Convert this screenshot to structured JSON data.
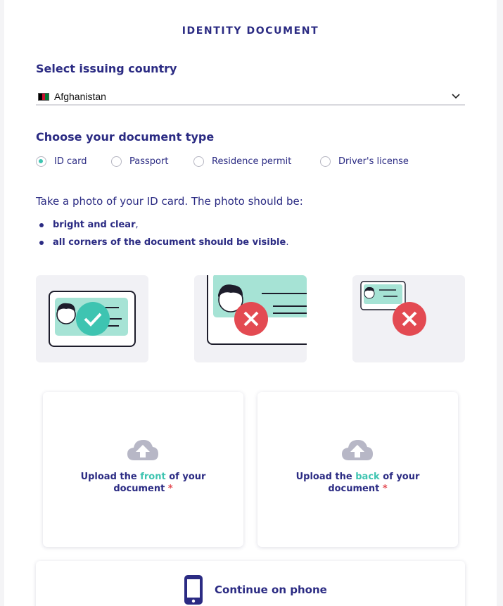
{
  "page": {
    "title": "IDENTITY DOCUMENT"
  },
  "country": {
    "label": "Select issuing country",
    "selected": "Afghanistan",
    "flag_colors": [
      "#000000",
      "#c8102e",
      "#007a36"
    ]
  },
  "document_type": {
    "label": "Choose your document type",
    "options": [
      {
        "label": "ID card",
        "checked": true
      },
      {
        "label": "Passport",
        "checked": false
      },
      {
        "label": "Residence permit",
        "checked": false
      },
      {
        "label": "Driver's license",
        "checked": false
      }
    ]
  },
  "instructions": {
    "text": "Take a photo of your ID card. The photo should be:",
    "bullets": [
      {
        "bold": "bright and clear",
        "suffix": ","
      },
      {
        "bold": "all corners of the document should be visible",
        "suffix": "."
      }
    ]
  },
  "examples": [
    {
      "icon": "id-card-correct-icon",
      "status": "correct"
    },
    {
      "icon": "id-card-cropped-icon",
      "status": "incorrect"
    },
    {
      "icon": "id-card-too-far-icon",
      "status": "incorrect"
    }
  ],
  "uploads": {
    "front": {
      "prefix": "Upload the ",
      "highlight": "front",
      "suffix": " of your document",
      "required_mark": "*",
      "icon": "cloud-upload-icon"
    },
    "back": {
      "prefix": "Upload the ",
      "highlight": "back",
      "suffix": " of your document",
      "required_mark": "*",
      "icon": "cloud-upload-icon"
    }
  },
  "continue": {
    "label": "Continue on phone",
    "icon": "smartphone-icon"
  },
  "colors": {
    "primary": "#2b2b83",
    "accent": "#3ec4b1",
    "error": "#e34a52",
    "card_green": "#a6e3d5"
  }
}
